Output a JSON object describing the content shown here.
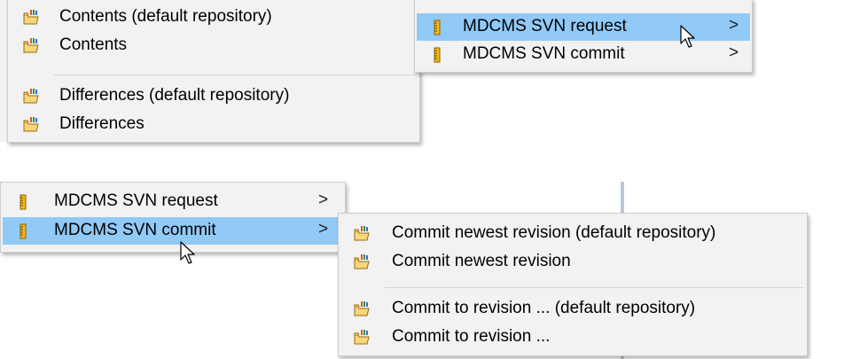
{
  "top": {
    "main_menu": {
      "items": [
        {
          "label": "Contents (default repository)",
          "icon": "svn-folder-icon"
        },
        {
          "label": "Contents",
          "icon": "svn-folder-icon"
        },
        {
          "label": "Differences (default repository)",
          "icon": "svn-folder-icon"
        },
        {
          "label": "Differences",
          "icon": "svn-folder-icon"
        }
      ]
    },
    "submenu": {
      "items": [
        {
          "label": "MDCMS SVN request",
          "arrow": ">",
          "icon": "mdcms-ruler-icon",
          "highlighted": true
        },
        {
          "label": "MDCMS SVN commit",
          "arrow": ">",
          "icon": "mdcms-ruler-icon",
          "highlighted": false
        }
      ]
    }
  },
  "bottom": {
    "main_menu": {
      "items": [
        {
          "label": "MDCMS SVN request",
          "arrow": ">",
          "icon": "mdcms-ruler-icon",
          "highlighted": false
        },
        {
          "label": "MDCMS SVN commit",
          "arrow": ">",
          "icon": "mdcms-ruler-icon",
          "highlighted": true
        }
      ]
    },
    "submenu": {
      "items": [
        {
          "label": "Commit newest revision (default repository)",
          "icon": "svn-folder-icon"
        },
        {
          "label": "Commit newest revision",
          "icon": "svn-folder-icon"
        },
        {
          "label": "Commit to revision ... (default repository)",
          "icon": "svn-folder-icon"
        },
        {
          "label": "Commit to revision ...",
          "icon": "svn-folder-icon"
        }
      ]
    }
  },
  "colors": {
    "menu_background": "#f2f2f2",
    "highlight": "#91c9f7",
    "border": "#cccccc"
  }
}
